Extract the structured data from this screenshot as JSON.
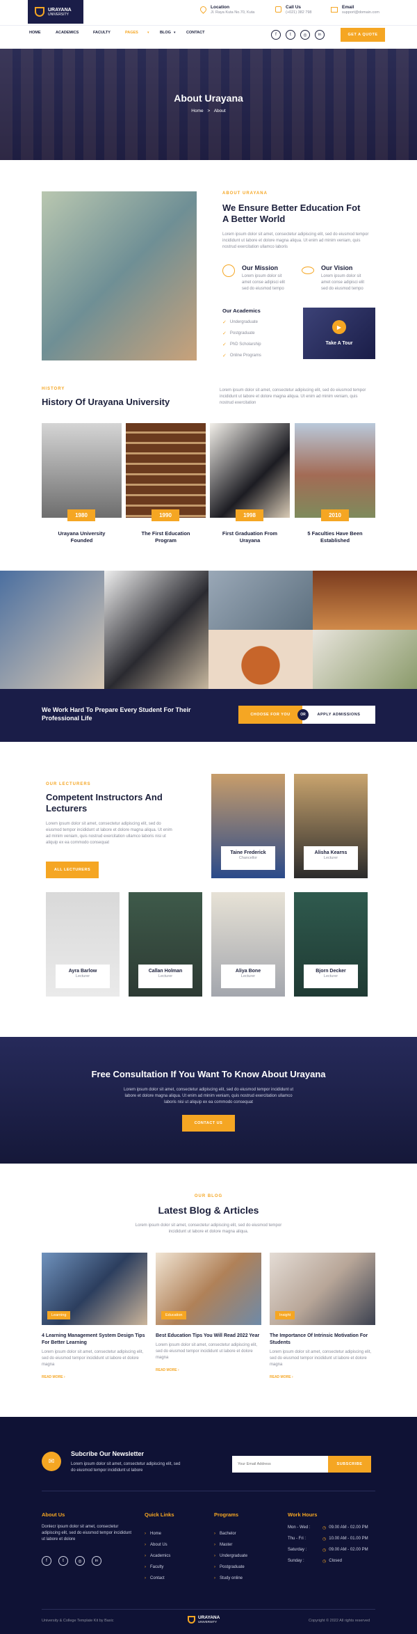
{
  "logo": {
    "name": "URAYANA",
    "sub": "UNIVERSITY"
  },
  "contact": {
    "location_label": "Location",
    "location_value": "Jl. Raya Kuta No.70, Kuta",
    "call_label": "Call Us",
    "call_value": "(+021) 382 798",
    "email_label": "Email",
    "email_value": "support@domain.com"
  },
  "nav": {
    "items": [
      "HOME",
      "ACADEMICS",
      "FACULTY",
      "PAGES",
      "BLOG",
      "CONTACT"
    ],
    "cta": "GET A QUOTE"
  },
  "hero": {
    "title": "About Urayana",
    "crumb_home": "Home",
    "crumb_sep": ">",
    "crumb_current": "About"
  },
  "about": {
    "kicker": "ABOUT URAYANA",
    "title": "We Ensure Better Education Fot A Better World",
    "text": "Lorem ipsum dolor sit amet, consectetur adipiscing elit, sed do eiusmod tempor incididunt ut labore et dolore magna aliqua. Ut enim ad minim veniam, quis nostrud exercitation ullamco laboris",
    "mission_title": "Our Mission",
    "mission_text": "Lorem ipsum dolor sit amet conse adipisci elit sed do eiusmod tempo",
    "vision_title": "Our Vision",
    "vision_text": "Lorem ipsum dolor sit amet conse adipisci elit sed do eiusmod tempo",
    "academics_title": "Our Academics",
    "academics": [
      "Undergraduate",
      "Postgraduate",
      "PhD Scholarship",
      "Online Programs"
    ],
    "tour": "Take A Tour"
  },
  "history": {
    "kicker": "HISTORY",
    "title": "History Of Urayana University",
    "text": "Lorem ipsum dolor sit amet, consectetur adipiscing elit, sed do eiusmod tempor incididunt ut labore et dolore magna aliqua. Ut enim ad minim veniam, quis nostrud exercitation",
    "items": [
      {
        "year": "1980",
        "title": "Urayana University Founded"
      },
      {
        "year": "1990",
        "title": "The First Education Program"
      },
      {
        "year": "1998",
        "title": "First Graduation From Urayana"
      },
      {
        "year": "2010",
        "title": "5 Faculties Have Been Established"
      }
    ]
  },
  "banner": {
    "text": "We Work Hard To Prepare Every Student For Their Professional Life",
    "btn1": "CHOOSE FOR YOU",
    "or": "OR",
    "btn2": "APPLY ADMISSIONS"
  },
  "lecturers": {
    "kicker": "OUR LECTURERS",
    "title": "Competent Instructors And Lecturers",
    "text": "Lorem ipsum dolor sit amet, consectetur adipiscing elit, sed do eiusmod tempor incididunt ut labore et dolore magna aliqua. Ut enim ad minim veniam, quis nostrud exercitation ullamco laboris nisi ut aliquip ex ea commodo consequat",
    "btn": "ALL LECTURERS",
    "people": [
      {
        "name": "Taine Frederick",
        "role": "Chancellor"
      },
      {
        "name": "Alisha Kearns",
        "role": "Lecturer"
      },
      {
        "name": "Ayra Barlow",
        "role": "Lecturer"
      },
      {
        "name": "Callan Holman",
        "role": "Lecturer"
      },
      {
        "name": "Aliya Bone",
        "role": "Lecturer"
      },
      {
        "name": "Bjorn Decker",
        "role": "Lecturer"
      }
    ]
  },
  "consult": {
    "title": "Free Consultation If You Want To Know About Urayana",
    "text": "Lorem ipsum dolor sit amet, consectetur adipiscing elit, sed do eiusmod tempor incididunt ut labore et dolore magna aliqua. Ut enim ad minim veniam, quis nostrud exercitation ullamco laboris nisi ut aliquip ex ea commodo consequat",
    "btn": "CONTACT US"
  },
  "blog": {
    "kicker": "OUR BLOG",
    "title": "Latest Blog & Articles",
    "text": "Lorem ipsum dolor sit amet, consectetur adipiscing elit, sed do eiusmod tempor incididunt ut labore et dolore magna aliqua.",
    "posts": [
      {
        "tag": "Learning",
        "title": "4 Learning Management System Design Tips For Better Learning",
        "text": "Lorem ipsum dolor sit amet, consectetur adipiscing elit, sed do eiusmod tempor incididunt ut labore et dolore magna",
        "more": "READ MORE"
      },
      {
        "tag": "Education",
        "title": "Best Education Tips You Will Read 2022 Year",
        "text": "Lorem ipsum dolor sit amet, consectetur adipiscing elit, sed do eiusmod tempor incididunt ut labore et dolore magna",
        "more": "READ MORE"
      },
      {
        "tag": "Insight",
        "title": "The Importance Of Intrinsic Motivation For Students",
        "text": "Lorem ipsum dolor sit amet, consectetur adipiscing elit, sed do eiusmod tempor incididunt ut labore et dolore magna",
        "more": "READ MORE"
      }
    ]
  },
  "newsletter": {
    "title": "Subcribe Our Newsletter",
    "text": "Lorem ipsum dolor sit amet, consectetur adipiscing elit, sed do eiusmod tempor incididunt ut labore",
    "placeholder": "Your Email Address",
    "btn": "SUBSCRIBE"
  },
  "footer": {
    "about_title": "About Us",
    "about_text": "Donlecr ipsum dolor sit amet, consectetur adipiscing elit, sed do eiusmod tempor incididunt ut labore et dolore",
    "links_title": "Quick Links",
    "links": [
      "Home",
      "About Us",
      "Academics",
      "Faculty",
      "Contact"
    ],
    "programs_title": "Programs",
    "programs": [
      "Bachelor",
      "Master",
      "Undergraduate",
      "Postgraduate",
      "Study online"
    ],
    "hours_title": "Work Hours",
    "hours": [
      {
        "day": "Mon - Wed :",
        "time": "09.00 AM - 02.00 PM"
      },
      {
        "day": "Thu - Fri :",
        "time": "10.00 AM - 01.00 PM"
      },
      {
        "day": "Saturday :",
        "time": "09.00 AM - 02.00 PM"
      },
      {
        "day": "Sunday :",
        "time": "Closed"
      }
    ],
    "bottom_left": "University & College Template Kit by Baxic",
    "bottom_right": "Copyright © 2022 All rights reserved"
  },
  "colors": {
    "navy": "#1a1d48",
    "orange": "#f5a623"
  }
}
